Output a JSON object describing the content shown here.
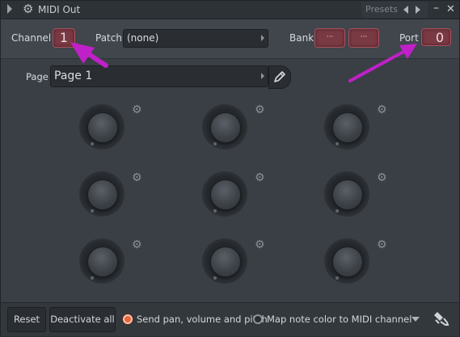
{
  "window": {
    "title": "MIDI Out",
    "presets_label": "Presets",
    "minimize_glyph": "–",
    "close_glyph": "✕"
  },
  "header": {
    "channel_label": "Channel",
    "channel_value": "1",
    "patch_label": "Patch",
    "patch_value": "(none)",
    "bank_label": "Bank",
    "bank_value_1": "···",
    "bank_value_2": "···",
    "port_label": "Port",
    "port_value": "0"
  },
  "page": {
    "label": "Page",
    "value": "Page 1"
  },
  "knobs": {
    "count": 9,
    "icon": "gear-icon"
  },
  "footer": {
    "reset_label": "Reset",
    "deactivate_label": "Deactivate all",
    "option_send_label": "Send pan, volume and pitch",
    "option_send_selected": true,
    "option_map_label": "Map note color to MIDI channel",
    "option_map_selected": false
  },
  "annotations": {
    "arrow_color": "#c020c8"
  },
  "colors": {
    "lcd_bg": "#7a3a44",
    "lcd_border": "#a9525e",
    "panel": "#3a3f45",
    "accent_radio": "#e8653a"
  }
}
